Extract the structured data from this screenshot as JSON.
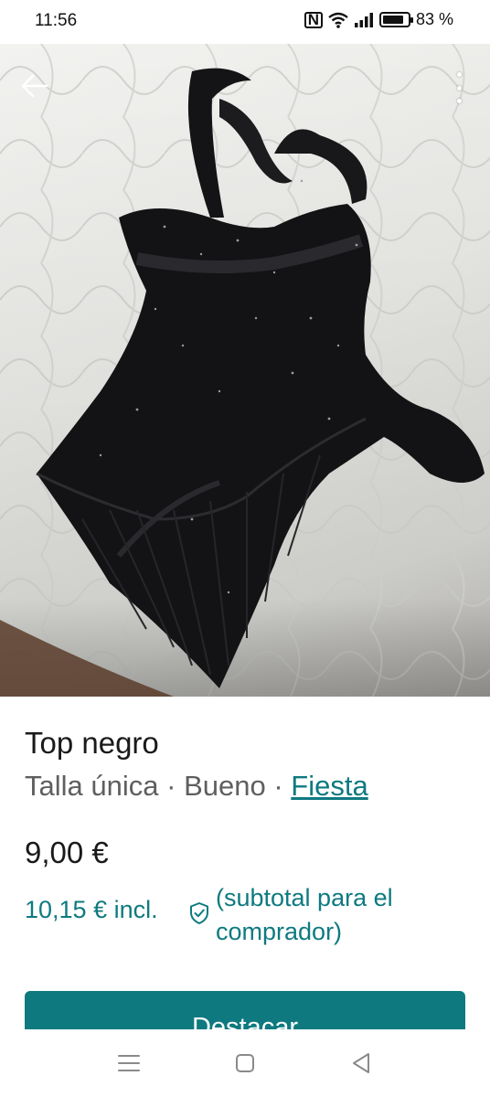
{
  "status_bar": {
    "time": "11:56",
    "battery_text": "83 %",
    "battery_level": 0.83,
    "icons": [
      "nfc-icon",
      "wifi-icon",
      "signal-icon",
      "battery-icon"
    ]
  },
  "photo": {
    "back_icon": "arrow-left-icon",
    "more_icon": "more-vertical-icon",
    "subject": "black top garment on white quilted bedspread"
  },
  "item": {
    "title": "Top negro",
    "size": "Talla única",
    "separator": "·",
    "condition": "Bueno",
    "category": "Fiesta",
    "price": "9,00 €",
    "buyer_price": "10,15 € incl.",
    "buyer_price_note": "(subtotal para el comprador)",
    "protection_icon": "shield-check-icon"
  },
  "actions": {
    "promote_label": "Destacar"
  },
  "nav_bar": {
    "icons": [
      "menu-icon",
      "home-icon",
      "back-icon"
    ]
  },
  "colors": {
    "accent": "#0e7a80",
    "text_primary": "#1a1a1a",
    "text_secondary": "#5f5f5f"
  }
}
